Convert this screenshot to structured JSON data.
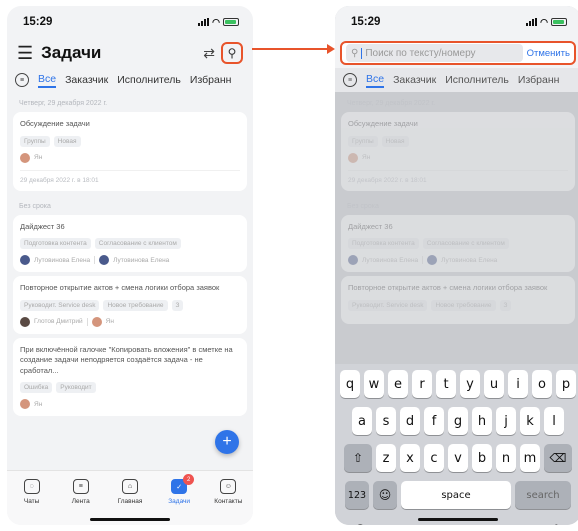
{
  "status": {
    "time": "15:29"
  },
  "left": {
    "title": "Задачи",
    "tabs": [
      "Все",
      "Заказчик",
      "Исполнитель",
      "Избранн"
    ],
    "groups": [
      {
        "date": "Четверг, 29 декабря 2022 г.",
        "cards": [
          {
            "title": "Обсуждение задачи",
            "chips": [
              "Группы",
              "Новая"
            ],
            "people": [
              "Ян"
            ],
            "foot": "29 декабря 2022 г. в 18:01"
          }
        ]
      },
      {
        "date": "Без срока",
        "cards": [
          {
            "title": "Дайджест 36",
            "chips": [
              "Подготовка контента",
              "Согласование с клиентом"
            ],
            "people": [
              "Лутовинова Елена",
              "Лутовинова Елена"
            ],
            "foot": ""
          },
          {
            "title": "Повторное открытие актов + смена логики отбора заявок",
            "chips": [
              "Руководит. Service desk",
              "Новое требование",
              "З"
            ],
            "people": [
              "Глотов Дмитрий",
              "Ян"
            ],
            "foot": ""
          },
          {
            "title": "При включённой галочке \"Копировать вложения\" в сметке на создание задачи неподряется создаётся задача - не сработал...",
            "chips": [
              "Ошибка",
              "Руководит"
            ],
            "people": [
              "Ян"
            ],
            "foot": ""
          }
        ]
      }
    ],
    "nav": [
      {
        "label": "Чаты",
        "icon": "chat-icon"
      },
      {
        "label": "Лента",
        "icon": "feed-icon"
      },
      {
        "label": "Главная",
        "icon": "home-icon"
      },
      {
        "label": "Задачи",
        "icon": "tasks-icon",
        "badge": "2",
        "active": true
      },
      {
        "label": "Контакты",
        "icon": "contacts-icon"
      }
    ]
  },
  "right": {
    "search_placeholder": "Поиск по тексту/номеру",
    "cancel": "Отменить",
    "keyboard": {
      "row1": [
        "q",
        "w",
        "e",
        "r",
        "t",
        "y",
        "u",
        "i",
        "o",
        "p"
      ],
      "row2": [
        "a",
        "s",
        "d",
        "f",
        "g",
        "h",
        "j",
        "k",
        "l"
      ],
      "row3": [
        "z",
        "x",
        "c",
        "v",
        "b",
        "n",
        "m"
      ],
      "num": "123",
      "space": "space",
      "search": "search"
    }
  },
  "colors": {
    "accent": "#2f74e8",
    "highlight": "#e8542b",
    "badge": "#ef5350"
  }
}
